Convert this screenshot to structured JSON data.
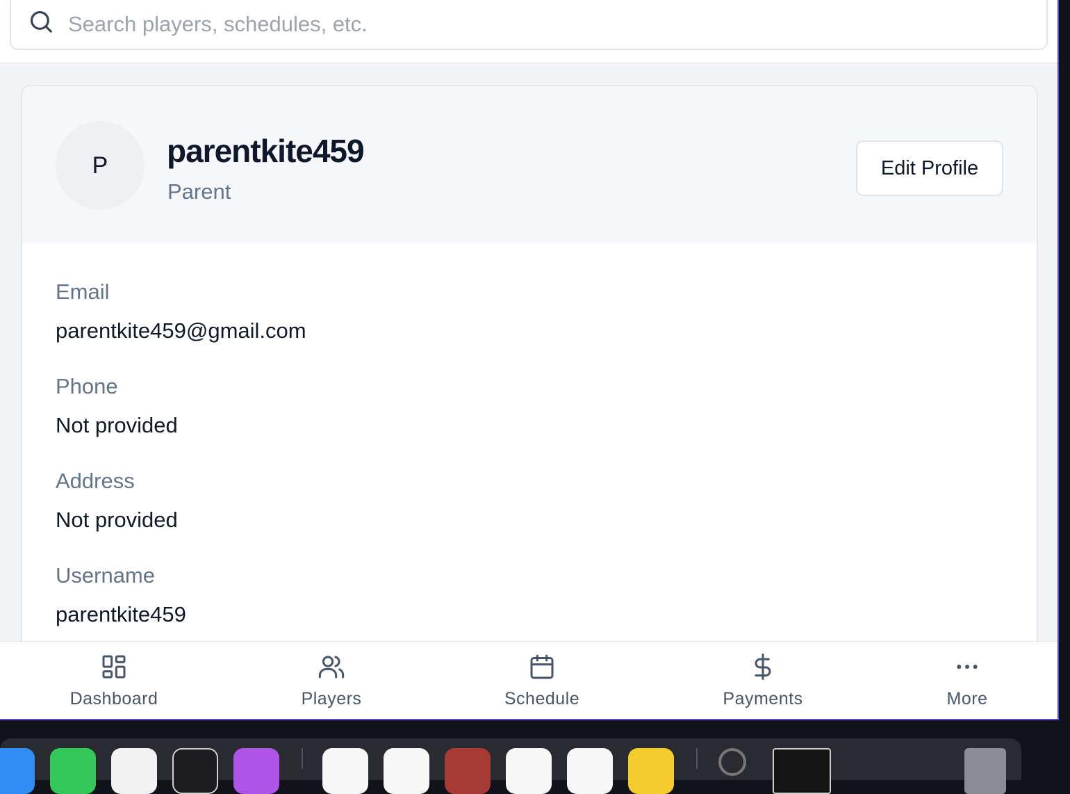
{
  "search": {
    "placeholder": "Search players, schedules, etc."
  },
  "profile": {
    "avatar_initial": "P",
    "name": "parentkite459",
    "role": "Parent",
    "edit_button": "Edit Profile"
  },
  "fields": [
    {
      "label": "Email",
      "value": "parentkite459@gmail.com"
    },
    {
      "label": "Phone",
      "value": "Not provided"
    },
    {
      "label": "Address",
      "value": "Not provided"
    },
    {
      "label": "Username",
      "value": "parentkite459"
    }
  ],
  "nav": [
    {
      "label": "Dashboard",
      "icon": "dashboard-icon"
    },
    {
      "label": "Players",
      "icon": "users-icon"
    },
    {
      "label": "Schedule",
      "icon": "calendar-icon"
    },
    {
      "label": "Payments",
      "icon": "dollar-icon"
    },
    {
      "label": "More",
      "icon": "more-icon"
    }
  ],
  "colors": {
    "accent_border": "#5b48c8",
    "text_primary": "#111827",
    "text_muted": "#64748b",
    "header_bg": "#f6f7fa"
  }
}
